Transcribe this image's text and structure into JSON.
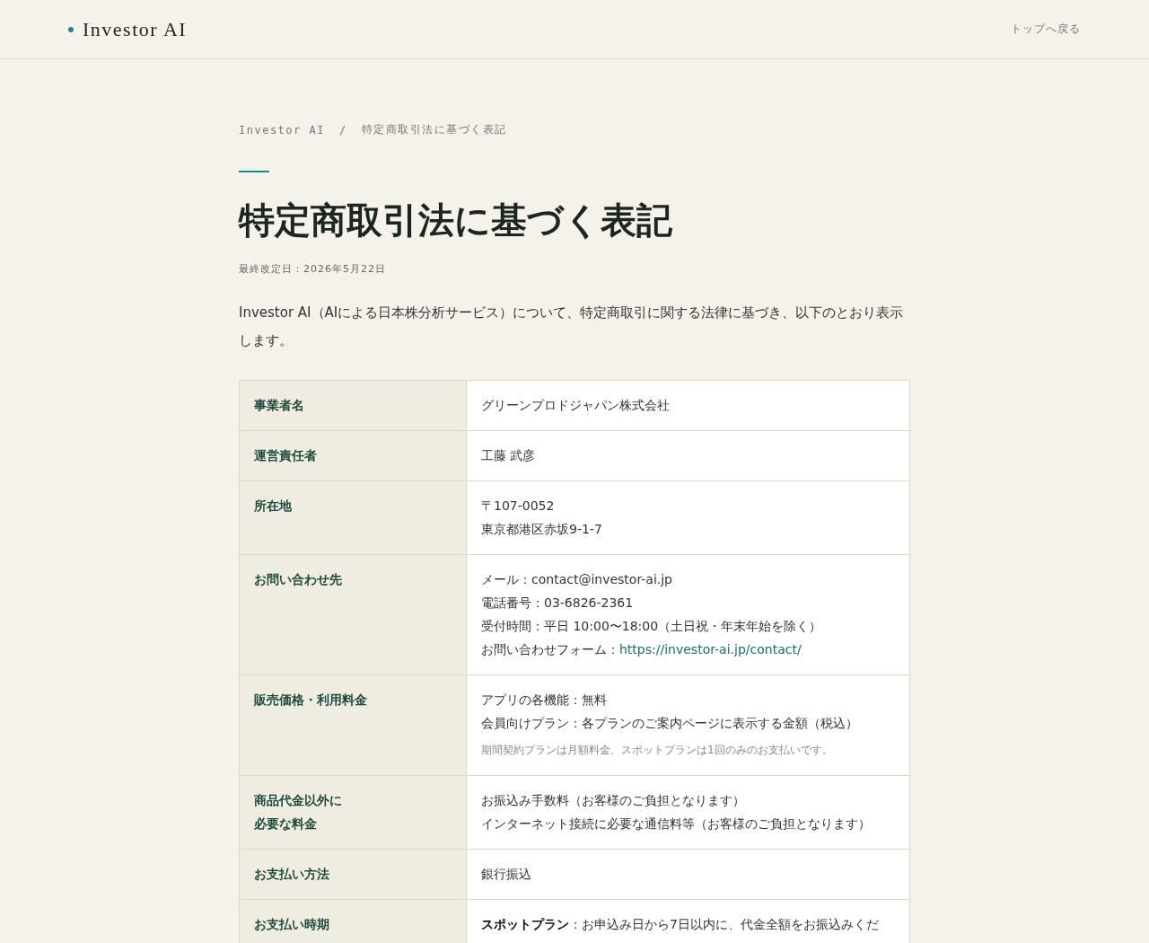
{
  "header": {
    "logo": "Investor AI",
    "back_link": "トップへ戻る"
  },
  "breadcrumb": [
    "Investor AI",
    "/",
    "特定商取引法に基づく表記"
  ],
  "title": "特定商取引法に基づく表記",
  "updated": "最終改定日：2026年5月22日",
  "intro": "Investor AI（AIによる日本株分析サービス）について、特定商取引に関する法律に基づき、以下のとおり表示します。",
  "table": {
    "rows": [
      {
        "label": [
          "事業者名"
        ],
        "lines": [
          {
            "kind": "text",
            "text": "グリーンプロドジャパン株式会社"
          }
        ]
      },
      {
        "label": [
          "運営責任者"
        ],
        "lines": [
          {
            "kind": "text",
            "text": "工藤 武彦"
          }
        ]
      },
      {
        "label": [
          "所在地"
        ],
        "lines": [
          {
            "kind": "text",
            "text": "〒107-0052"
          },
          {
            "kind": "text",
            "text": "東京都港区赤坂9-1-7"
          }
        ]
      },
      {
        "label": [
          "お問い合わせ先"
        ],
        "lines": [
          {
            "kind": "text",
            "text": "メール：contact@investor-ai.jp"
          },
          {
            "kind": "text",
            "text": "電話番号：03-6826-2361"
          },
          {
            "kind": "text",
            "text": "受付時間：平日 10:00〜18:00（土日祝・年末年始を除く）"
          },
          {
            "kind": "link",
            "text": "お問い合わせフォーム：",
            "link": "https://investor-ai.jp/contact/"
          }
        ]
      },
      {
        "label": [
          "販売価格・利用料金"
        ],
        "lines": [
          {
            "kind": "text",
            "text": "アプリの各機能：無料"
          },
          {
            "kind": "text",
            "text": "会員向けプラン：各プランのご案内ページに表示する金額（税込）"
          },
          {
            "kind": "note",
            "text": "期間契約プランは月額料金、スポットプランは1回のみのお支払いです。"
          }
        ]
      },
      {
        "label": [
          "商品代金以外に",
          "必要な料金"
        ],
        "lines": [
          {
            "kind": "text",
            "text": "お振込み手数料（お客様のご負担となります）"
          },
          {
            "kind": "text",
            "text": "インターネット接続に必要な通信料等（お客様のご負担となります）"
          }
        ]
      },
      {
        "label": [
          "お支払い方法"
        ],
        "lines": [
          {
            "kind": "text",
            "text": "銀行振込"
          }
        ]
      },
      {
        "label": [
          "お支払い時期"
        ],
        "lines": [
          {
            "kind": "text",
            "text": "**スポットプラン**：お申込み日から7日以内に、代金全額をお振込みくだ"
          }
        ]
      }
    ]
  }
}
